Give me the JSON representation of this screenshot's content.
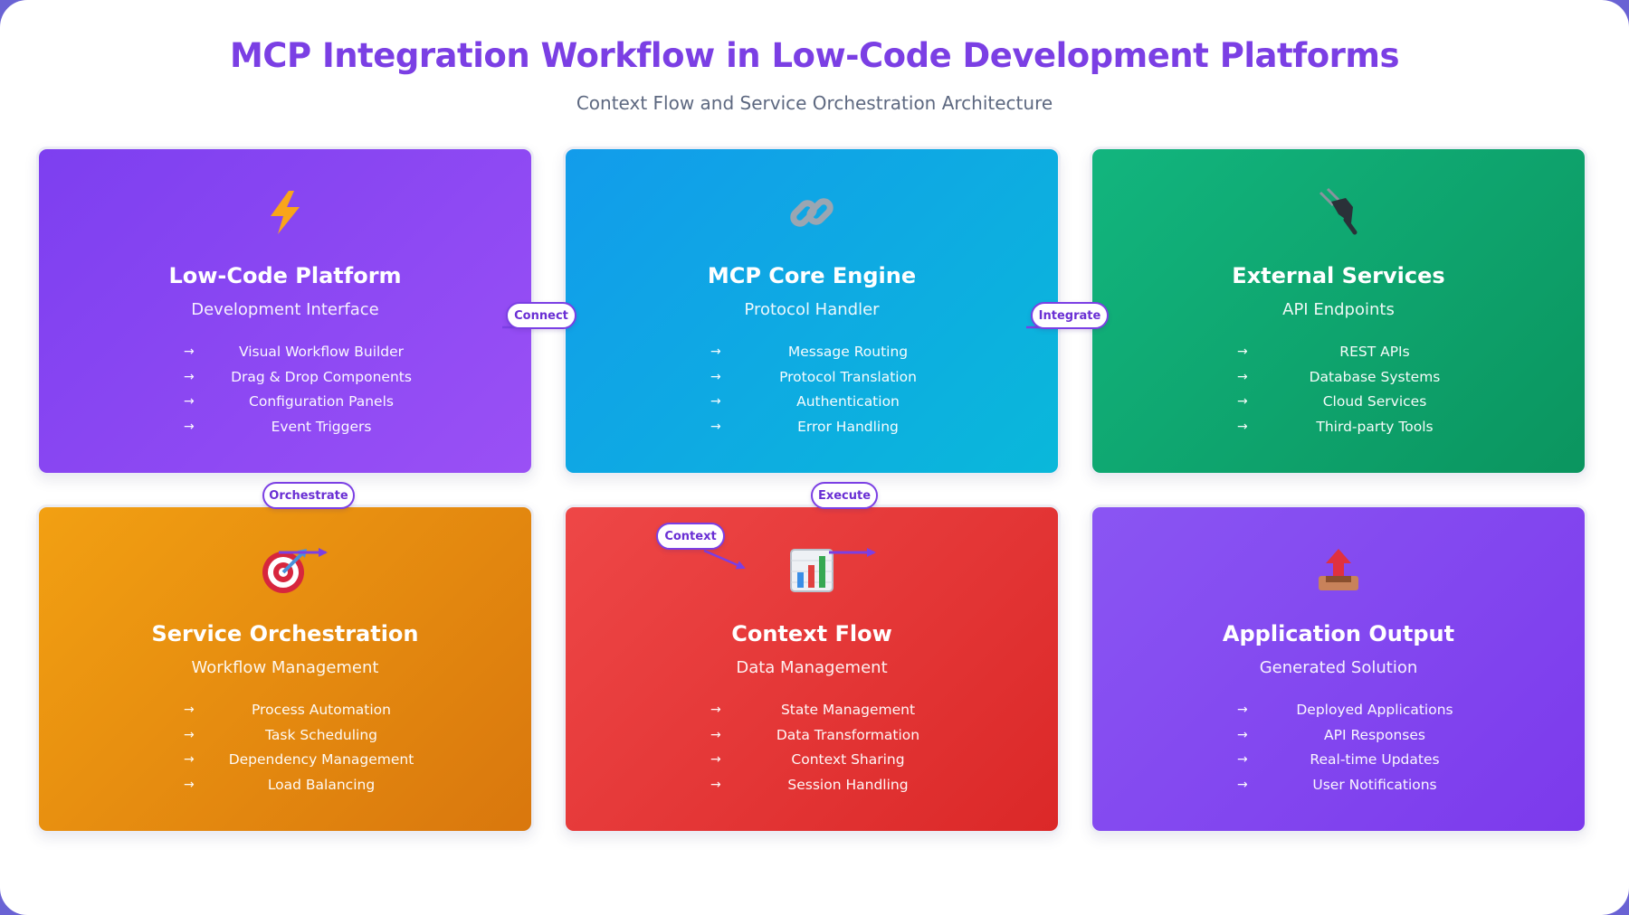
{
  "title": "MCP Integration Workflow in Low-Code Development Platforms",
  "subtitle": "Context Flow and Service Orchestration Architecture",
  "colors": {
    "title": "#7b3fe4",
    "card_purple": "#8a46f2",
    "card_blue": "#10aae3",
    "card_green": "#10a56f",
    "card_orange": "#e88c10",
    "card_red": "#e43838",
    "card_violet": "#8347ef",
    "connector": "#7b3fe4"
  },
  "cards": [
    {
      "icon": "lightning-icon",
      "title": "Low-Code Platform",
      "subtitle": "Development Interface",
      "items": [
        "Visual Workflow Builder",
        "Drag & Drop Components",
        "Configuration Panels",
        "Event Triggers"
      ]
    },
    {
      "icon": "link-icon",
      "title": "MCP Core Engine",
      "subtitle": "Protocol Handler",
      "items": [
        "Message Routing",
        "Protocol Translation",
        "Authentication",
        "Error Handling"
      ]
    },
    {
      "icon": "plug-icon",
      "title": "External Services",
      "subtitle": "API Endpoints",
      "items": [
        "REST APIs",
        "Database Systems",
        "Cloud Services",
        "Third-party Tools"
      ]
    },
    {
      "icon": "target-icon",
      "title": "Service Orchestration",
      "subtitle": "Workflow Management",
      "items": [
        "Process Automation",
        "Task Scheduling",
        "Dependency Management",
        "Load Balancing"
      ]
    },
    {
      "icon": "bar-chart-icon",
      "title": "Context Flow",
      "subtitle": "Data Management",
      "items": [
        "State Management",
        "Data Transformation",
        "Context Sharing",
        "Session Handling"
      ]
    },
    {
      "icon": "outbox-tray-icon",
      "title": "Application Output",
      "subtitle": "Generated Solution",
      "items": [
        "Deployed Applications",
        "API Responses",
        "Real-time Updates",
        "User Notifications"
      ]
    }
  ],
  "arrow_glyph": "→",
  "connectors": {
    "connect": "Connect",
    "integrate": "Integrate",
    "orchestrate": "Orchestrate",
    "execute": "Execute",
    "context": "Context"
  }
}
